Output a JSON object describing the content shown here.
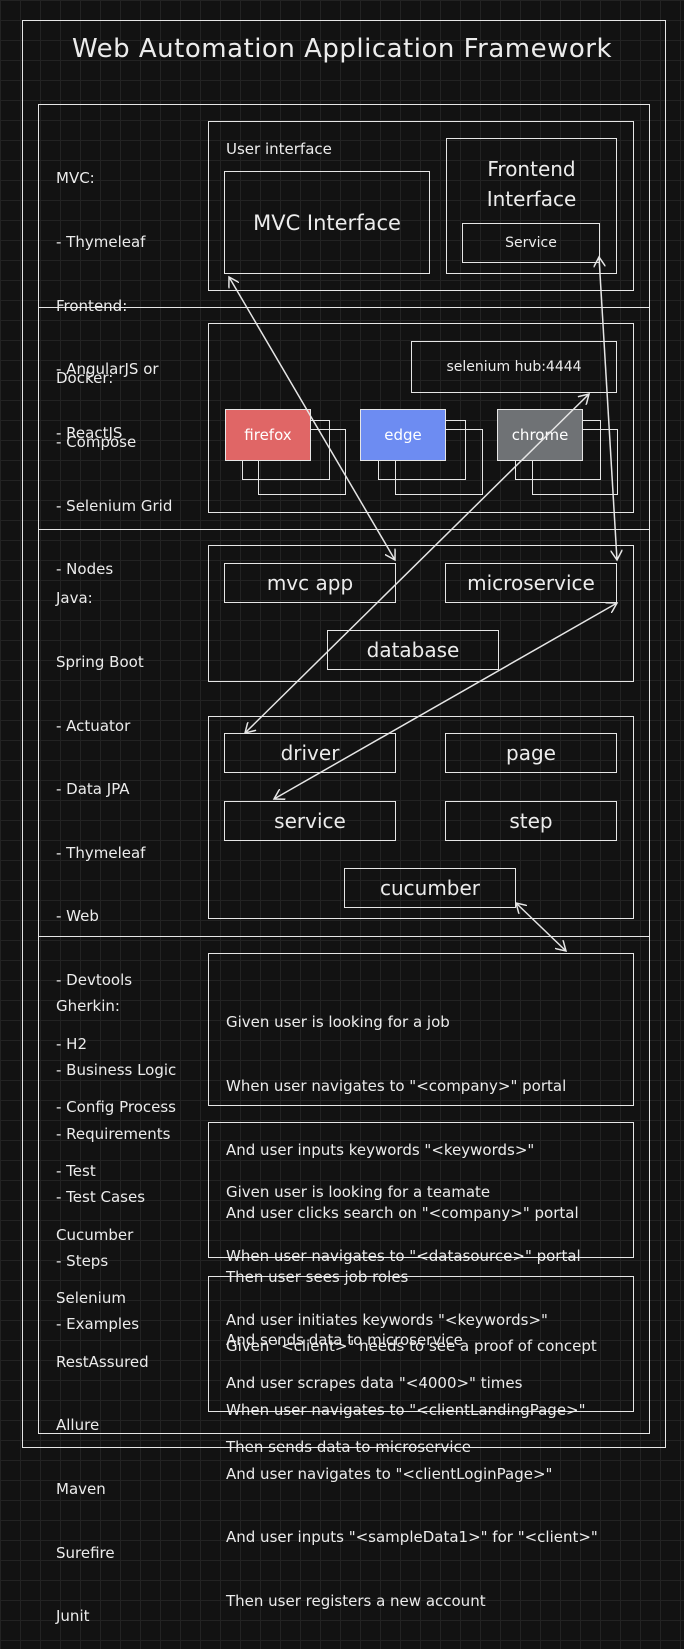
{
  "title": "Web Automation Application Framework",
  "sections": {
    "mvc_notes": [
      "MVC:",
      "- Thymeleaf",
      "Frontend:",
      "- AngularJS or",
      "- ReactJS"
    ],
    "docker_notes": [
      "Docker:",
      "- Compose",
      "- Selenium Grid",
      "- Nodes"
    ],
    "java_notes": [
      "Java:",
      "Spring Boot",
      "- Actuator",
      "- Data JPA",
      "- Thymeleaf",
      "- Web",
      "- Devtools",
      "- H2",
      "- Config Process",
      "- Test",
      "Cucumber",
      "Selenium",
      "RestAssured",
      "Allure",
      "Maven",
      "Surefire",
      "Junit"
    ],
    "gherkin_notes": [
      "Gherkin:",
      "- Business Logic",
      "- Requirements",
      "- Test Cases",
      "- Steps",
      "- Examples"
    ]
  },
  "ui": {
    "user_interface_label": "User interface",
    "mvc_interface": "MVC Interface",
    "frontend_interface": "Frontend\nInterface",
    "service": "Service"
  },
  "docker": {
    "hub": "selenium hub:4444",
    "browsers": [
      {
        "label": "firefox",
        "color": "#e06666"
      },
      {
        "label": "edge",
        "color": "#6d8cf2"
      },
      {
        "label": "chrome",
        "color": "#6f7275"
      }
    ]
  },
  "java": {
    "mvc_app": "mvc app",
    "microservice": "microservice",
    "database": "database",
    "driver": "driver",
    "page": "page",
    "service": "service",
    "step": "step",
    "cucumber": "cucumber"
  },
  "scenarios": [
    [
      "Given user is looking for a job",
      "When user navigates to \"<company>\" portal",
      "And user inputs keywords \"<keywords>\"",
      "And user clicks search on \"<company>\" portal",
      "Then user sees job roles",
      "And sends data to microservice"
    ],
    [
      "Given user is looking for a teamate",
      "When user navigates to \"<datasource>\" portal",
      "And user initiates keywords \"<keywords>\"",
      "And user scrapes data \"<4000>\" times",
      "Then sends data to microservice"
    ],
    [
      "Given \"<client>\" needs to see a proof of concept",
      "When user navigates to \"<clientLandingPage>\"",
      "And user navigates to \"<clientLoginPage>\"",
      "And user inputs \"<sampleData1>\" for \"<client>\"",
      "Then user registers a new account"
    ]
  ]
}
